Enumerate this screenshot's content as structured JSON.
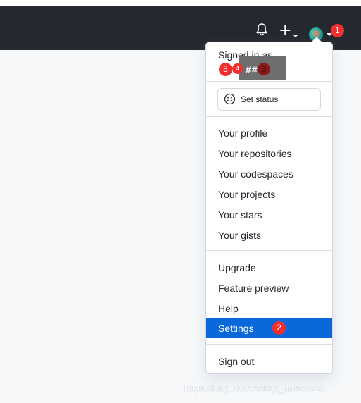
{
  "header": {
    "notifications_icon": "bell-icon",
    "create_icon": "plus-icon",
    "avatar_icon": "avatar"
  },
  "markers": {
    "m1": "1",
    "m2": "2",
    "m3": "3",
    "m4": "4",
    "m5": "5"
  },
  "menu": {
    "signed_in_as": "Signed in as",
    "username_mask": "##",
    "set_status": "Set status",
    "section_profile": [
      "Your profile",
      "Your repositories",
      "Your codespaces",
      "Your projects",
      "Your stars",
      "Your gists"
    ],
    "section_help": [
      "Upgrade",
      "Feature preview",
      "Help",
      "Settings"
    ],
    "sign_out": "Sign out"
  },
  "watermark": "https://blog.csdn.net/qq_44866828",
  "colors": {
    "header_bg": "#24292f",
    "highlight": "#0969da",
    "marker": "#f42e2e"
  }
}
